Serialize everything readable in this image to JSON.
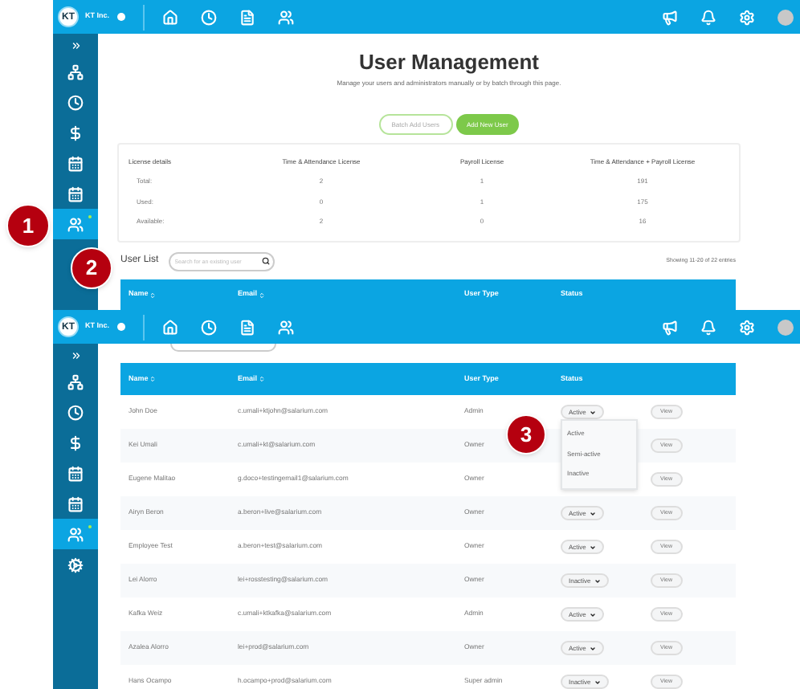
{
  "callouts": [
    {
      "label": "1"
    },
    {
      "label": "2"
    },
    {
      "label": "3"
    }
  ],
  "screen_1": {
    "header": {
      "logo": "KT",
      "company": "KT Inc."
    },
    "sidebar": [
      {
        "kind": "expand",
        "selected": false
      },
      {
        "kind": "org",
        "selected": false
      },
      {
        "kind": "clock",
        "selected": false
      },
      {
        "kind": "dollar",
        "selected": false
      },
      {
        "kind": "calendar",
        "selected": false
      },
      {
        "kind": "calendar",
        "selected": false
      },
      {
        "kind": "people",
        "selected": true
      }
    ],
    "page": {
      "title": "User Management",
      "subtitle": "Manage your users and administrators manually or by batch through this page.",
      "buttons": [
        {
          "label": "Batch Add Users",
          "kind": "outline"
        },
        {
          "label": "Add New User",
          "kind": "primary"
        }
      ],
      "license": {
        "columns": [
          "License details",
          "Time & Attendance License",
          "Payroll License",
          "Time & Attendance + Payroll License"
        ],
        "rows": [
          [
            "Total:",
            "2",
            "1",
            "191"
          ],
          [
            "Used:",
            "0",
            "1",
            "175"
          ],
          [
            "Available:",
            "2",
            "0",
            "16"
          ]
        ]
      },
      "user_list": {
        "label": "User List",
        "search": {
          "placeholder": "Search for an existing user"
        },
        "entries": "Showing 11-20 of 22 entries",
        "columns": [
          {
            "label": "Name",
            "sortable": true
          },
          {
            "label": "Email",
            "sortable": true
          },
          {
            "label": "User Type",
            "sortable": false
          },
          {
            "label": "Status",
            "sortable": false
          }
        ]
      }
    }
  },
  "screen_2": {
    "header": {
      "logo": "KT",
      "company": "KT Inc."
    },
    "sidebar": [
      {
        "kind": "expand",
        "selected": false
      },
      {
        "kind": "org",
        "selected": false
      },
      {
        "kind": "clock",
        "selected": false
      },
      {
        "kind": "dollar",
        "selected": false
      },
      {
        "kind": "calendar",
        "selected": false
      },
      {
        "kind": "calendar",
        "selected": false
      },
      {
        "kind": "people",
        "selected": true
      },
      {
        "kind": "gears",
        "selected": false
      }
    ],
    "table": {
      "columns": [
        {
          "label": "Name",
          "sortable": true
        },
        {
          "label": "Email",
          "sortable": true
        },
        {
          "label": "User Type",
          "sortable": false
        },
        {
          "label": "Status",
          "sortable": false
        }
      ],
      "rows": [
        {
          "name": "John Doe",
          "email": "c.umali+ktjohn@salarium.com",
          "user_type": "Admin",
          "status": "Active",
          "action": "View",
          "menu": {
            "options": [
              "Active",
              "Semi-active",
              "Inactive"
            ]
          }
        },
        {
          "name": "Kei Umali",
          "email": "c.umali+kt@salarium.com",
          "user_type": "Owner",
          "action": "View"
        },
        {
          "name": "Eugene Malitao",
          "email": "g.doco+testingemail1@salarium.com",
          "user_type": "Owner",
          "action": "View"
        },
        {
          "name": "Airyn Beron",
          "email": "a.beron+live@salarium.com",
          "user_type": "Owner",
          "status": "Active",
          "action": "View"
        },
        {
          "name": "Employee Test",
          "email": "a.beron+test@salarium.com",
          "user_type": "Owner",
          "status": "Active",
          "action": "View"
        },
        {
          "name": "Lei Alorro",
          "email": "lei+rosstesting@salarium.com",
          "user_type": "Owner",
          "status": "Inactive",
          "action": "View"
        },
        {
          "name": "Kafka Weiz",
          "email": "c.umali+ktkafka@salarium.com",
          "user_type": "Admin",
          "status": "Active",
          "action": "View"
        },
        {
          "name": "Azalea Alorro",
          "email": "lei+prod@salarium.com",
          "user_type": "Owner",
          "status": "Active",
          "action": "View"
        },
        {
          "name": "Hans Ocampo",
          "email": "h.ocampo+prod@salarium.com",
          "user_type": "Super admin",
          "status": "Inactive",
          "action": "View"
        }
      ]
    }
  }
}
